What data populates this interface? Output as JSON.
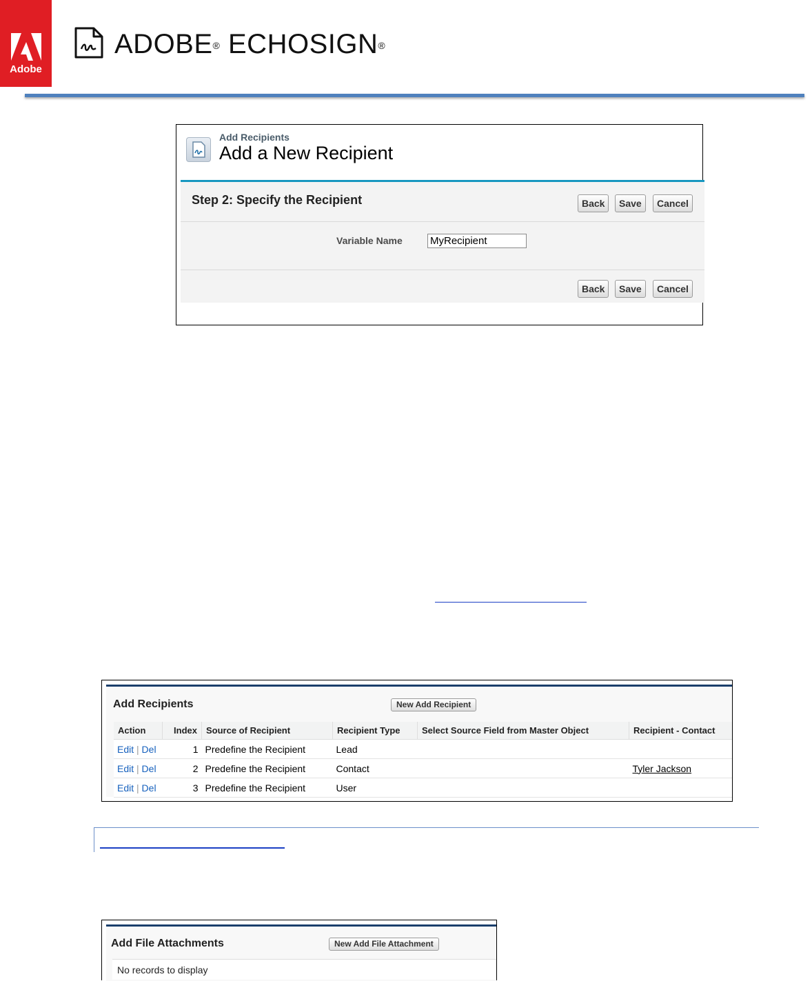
{
  "header": {
    "adobe_wordmark": "Adobe",
    "brand_name": "ADOBE",
    "brand_product": "ECHOSIGN",
    "registered_mark": "®"
  },
  "screenshot1": {
    "breadcrumb": "Add Recipients",
    "title": "Add a New Recipient",
    "step_title": "Step 2: Specify the Recipient",
    "buttons": {
      "back": "Back",
      "save": "Save",
      "cancel": "Cancel"
    },
    "variable_name_label": "Variable Name",
    "variable_name_value": "MyRecipient"
  },
  "screenshot2": {
    "title": "Add Recipients",
    "new_button": "New Add Recipient",
    "columns": [
      "Action",
      "Index",
      "Source of Recipient",
      "Recipient Type",
      "Select Source Field from Master Object",
      "Recipient - Contact"
    ],
    "edit_label": "Edit",
    "del_label": "Del",
    "separator": "|",
    "rows": [
      {
        "index": "1",
        "source": "Predefine the Recipient",
        "type": "Lead",
        "field": "",
        "contact": ""
      },
      {
        "index": "2",
        "source": "Predefine the Recipient",
        "type": "Contact",
        "field": "",
        "contact": "Tyler Jackson"
      },
      {
        "index": "3",
        "source": "Predefine the Recipient",
        "type": "User",
        "field": "",
        "contact": ""
      }
    ]
  },
  "screenshot3": {
    "title": "Add File Attachments",
    "new_button": "New Add File Attachment",
    "empty_message": "No records to display"
  },
  "colors": {
    "adobe_red": "#e01e24",
    "header_rule": "#4f81bd",
    "panel_accent": "#1797c0",
    "related_list_accent": "#1a3e6b",
    "link_blue": "#1560bd"
  }
}
